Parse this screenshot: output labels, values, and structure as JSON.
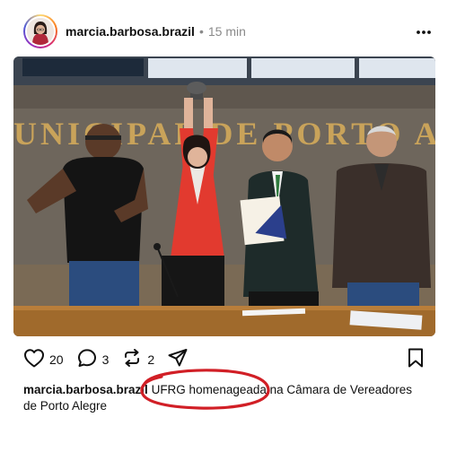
{
  "post": {
    "username": "marcia.barbosa.brazil",
    "separator": "•",
    "timestamp": "15 min",
    "more_icon": "more-horizontal-icon"
  },
  "image": {
    "sign_text": "UNICIPAL DE PORTO A",
    "description_colors": {
      "wall": "#6d645a",
      "wood": "#a06a2c",
      "jacket": "#e23a2f"
    }
  },
  "actions": {
    "like": {
      "icon": "heart-icon",
      "count": "20"
    },
    "comment": {
      "icon": "comment-icon",
      "count": "3"
    },
    "repost": {
      "icon": "repost-icon",
      "count": "2"
    },
    "share": {
      "icon": "send-icon"
    },
    "bookmark": {
      "icon": "bookmark-icon"
    }
  },
  "caption": {
    "username": "marcia.barbosa.brazil",
    "text": " UFRG homenageada na Câmara de Vereadores de Porto Alegre",
    "annotation_color": "#d11f26"
  }
}
